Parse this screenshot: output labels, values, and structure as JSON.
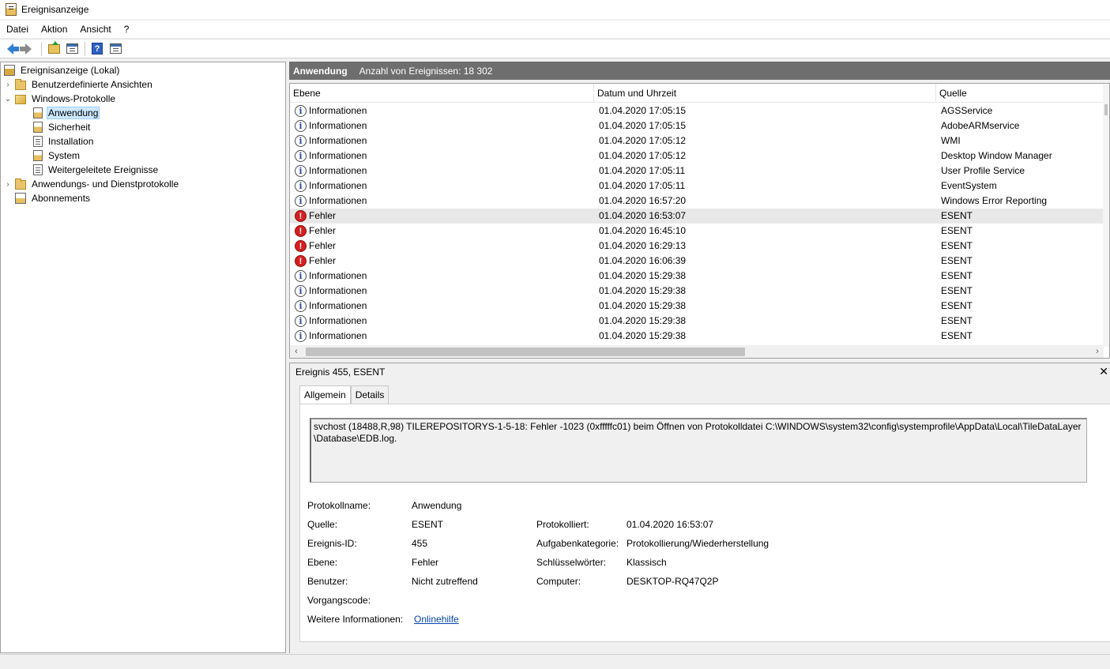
{
  "window": {
    "title": "Ereignisanzeige"
  },
  "menu": [
    "Datei",
    "Aktion",
    "Ansicht",
    "?"
  ],
  "toolbar": {
    "buttons": [
      "back-icon",
      "forward-icon",
      "folder-up-icon",
      "show-hide-tree-icon",
      "help-icon",
      "show-hide-action-icon"
    ]
  },
  "tree": {
    "root": "Ereignisanzeige (Lokal)",
    "custom_views": "Benutzerdefinierte Ansichten",
    "windows_logs": "Windows-Protokolle",
    "logs": [
      "Anwendung",
      "Sicherheit",
      "Installation",
      "System",
      "Weitergeleitete Ereignisse"
    ],
    "app_service_logs": "Anwendungs- und Dienstprotokolle",
    "subscriptions": "Abonnements",
    "selected": "Anwendung"
  },
  "header": {
    "title": "Anwendung",
    "count": "Anzahl von Ereignissen: 18 302"
  },
  "grid": {
    "columns": [
      "Ebene",
      "Datum und Uhrzeit",
      "Quelle"
    ],
    "rows": [
      {
        "level": "Informationen",
        "type": "info",
        "date": "01.04.2020 17:05:15",
        "source": "AGSService"
      },
      {
        "level": "Informationen",
        "type": "info",
        "date": "01.04.2020 17:05:15",
        "source": "AdobeARMservice"
      },
      {
        "level": "Informationen",
        "type": "info",
        "date": "01.04.2020 17:05:12",
        "source": "WMI"
      },
      {
        "level": "Informationen",
        "type": "info",
        "date": "01.04.2020 17:05:12",
        "source": "Desktop Window Manager"
      },
      {
        "level": "Informationen",
        "type": "info",
        "date": "01.04.2020 17:05:11",
        "source": "User Profile Service"
      },
      {
        "level": "Informationen",
        "type": "info",
        "date": "01.04.2020 17:05:11",
        "source": "EventSystem"
      },
      {
        "level": "Informationen",
        "type": "info",
        "date": "01.04.2020 16:57:20",
        "source": "Windows Error Reporting"
      },
      {
        "level": "Fehler",
        "type": "error",
        "date": "01.04.2020 16:53:07",
        "source": "ESENT",
        "selected": true
      },
      {
        "level": "Fehler",
        "type": "error",
        "date": "01.04.2020 16:45:10",
        "source": "ESENT"
      },
      {
        "level": "Fehler",
        "type": "error",
        "date": "01.04.2020 16:29:13",
        "source": "ESENT"
      },
      {
        "level": "Fehler",
        "type": "error",
        "date": "01.04.2020 16:06:39",
        "source": "ESENT"
      },
      {
        "level": "Informationen",
        "type": "info",
        "date": "01.04.2020 15:29:38",
        "source": "ESENT"
      },
      {
        "level": "Informationen",
        "type": "info",
        "date": "01.04.2020 15:29:38",
        "source": "ESENT"
      },
      {
        "level": "Informationen",
        "type": "info",
        "date": "01.04.2020 15:29:38",
        "source": "ESENT"
      },
      {
        "level": "Informationen",
        "type": "info",
        "date": "01.04.2020 15:29:38",
        "source": "ESENT"
      },
      {
        "level": "Informationen",
        "type": "info",
        "date": "01.04.2020 15:29:38",
        "source": "ESENT"
      }
    ]
  },
  "detail": {
    "title": "Ereignis 455, ESENT",
    "close": "✕",
    "tabs": [
      "Allgemein",
      "Details"
    ],
    "message": "svchost (18488,R,98) TILEREPOSITORYS-1-5-18: Fehler -1023 (0xfffffc01) beim Öffnen von Protokolldatei C:\\WINDOWS\\system32\\config\\systemprofile\\AppData\\Local\\TileDataLayer\\Database\\EDB.log.",
    "message_line1": "svchost (18488,R,98) TILEREPOSITORYS-1-5-18: Fehler -1023 (0xfffffc01) beim Öffnen von Protokolldatei C:\\WINDOWS\\system32\\config\\systemprofile\\AppData\\Local\\TileDataLayer",
    "message_line2": "\\Database\\EDB.log.",
    "labels": {
      "protokollname": "Protokollname:",
      "quelle": "Quelle:",
      "ereignis_id": "Ereignis-ID:",
      "ebene": "Ebene:",
      "benutzer": "Benutzer:",
      "vorgangscode": "Vorgangscode:",
      "weitere": "Weitere Informationen:",
      "protokolliert": "Protokolliert:",
      "aufgabenkategorie": "Aufgabenkategorie:",
      "schluesselwoerter": "Schlüsselwörter:",
      "computer": "Computer:"
    },
    "values": {
      "protokollname": "Anwendung",
      "quelle": "ESENT",
      "ereignis_id": "455",
      "ebene": "Fehler",
      "benutzer": "Nicht zutreffend",
      "vorgangscode": "",
      "weitere": "Onlinehilfe",
      "protokolliert": "01.04.2020 16:53:07",
      "aufgabenkategorie": "Protokollierung/Wiederherstellung",
      "schluesselwoerter": "Klassisch",
      "computer": "DESKTOP-RQ47Q2P"
    }
  }
}
